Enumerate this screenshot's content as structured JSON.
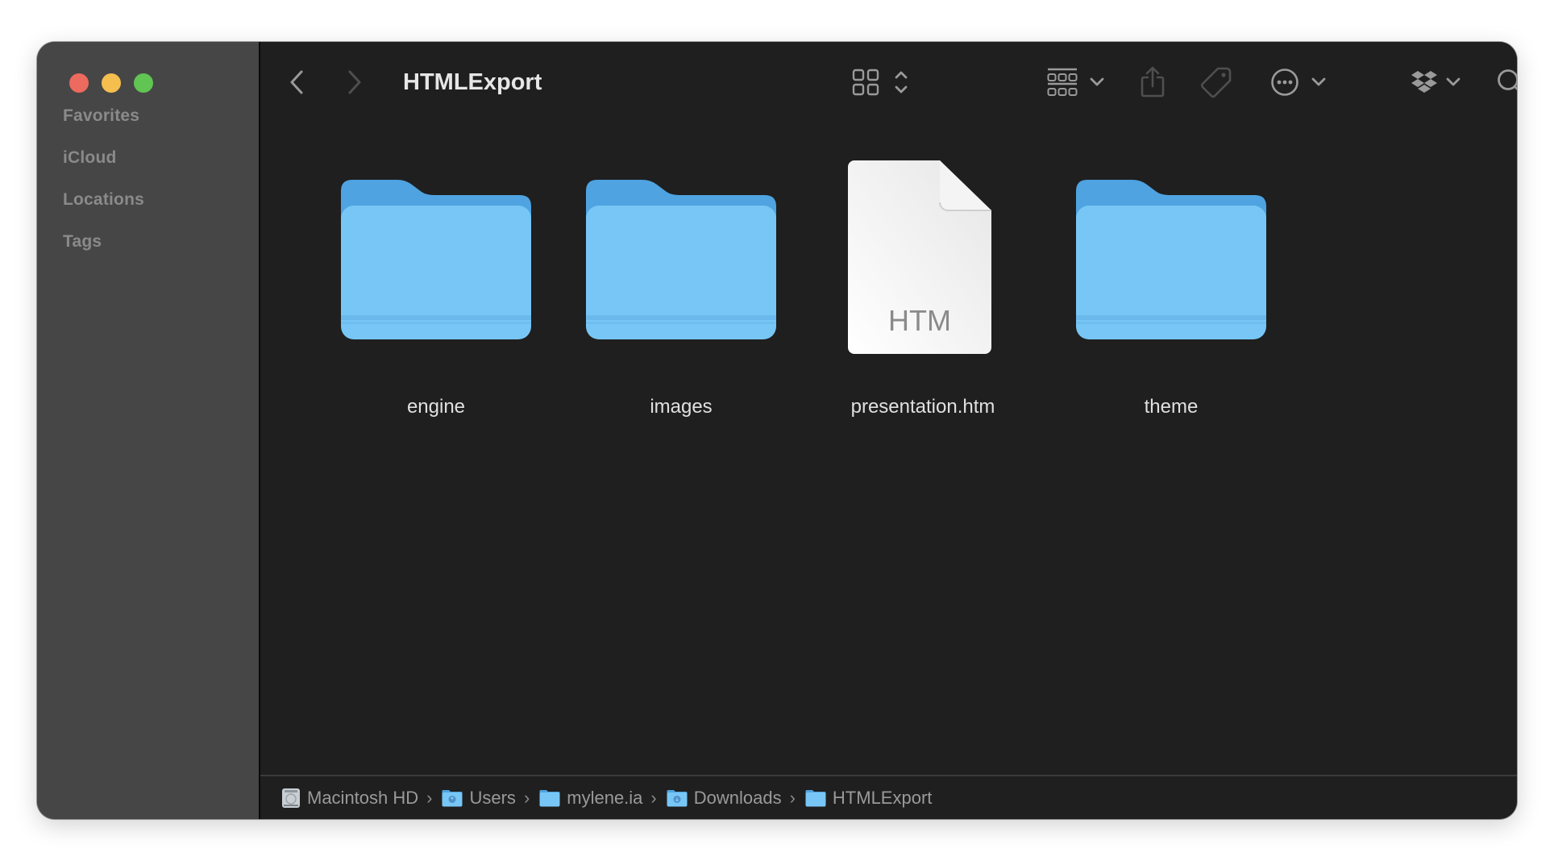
{
  "window": {
    "title": "HTMLExport",
    "traffic_lights": [
      {
        "name": "close",
        "color": "#ed6a5e"
      },
      {
        "name": "minimize",
        "color": "#f5bf4f"
      },
      {
        "name": "zoom",
        "color": "#61c554"
      }
    ]
  },
  "sidebar": {
    "sections": [
      {
        "label": "Favorites"
      },
      {
        "label": "iCloud"
      },
      {
        "label": "Locations"
      },
      {
        "label": "Tags"
      }
    ]
  },
  "toolbar": {
    "back": "chevron-left-icon",
    "forward": "chevron-right-icon",
    "title": "HTMLExport",
    "view_mode": "icon-view",
    "group": "group-by",
    "share": {
      "icon": "share-icon",
      "enabled": false
    },
    "tag": {
      "icon": "tag-icon",
      "enabled": false
    },
    "more": "ellipsis-circle-icon",
    "dropbox": "dropbox-icon",
    "search": "search-icon"
  },
  "items": [
    {
      "name": "engine",
      "kind": "folder"
    },
    {
      "name": "images",
      "kind": "folder"
    },
    {
      "name": "presentation.htm",
      "kind": "file",
      "badge": "HTM"
    },
    {
      "name": "theme",
      "kind": "folder"
    }
  ],
  "pathbar": [
    {
      "label": "Macintosh HD",
      "icon": "hard-drive-icon"
    },
    {
      "label": "Users",
      "icon": "users-folder-icon"
    },
    {
      "label": "mylene.ia",
      "icon": "folder-icon"
    },
    {
      "label": "Downloads",
      "icon": "downloads-folder-icon"
    },
    {
      "label": "HTMLExport",
      "icon": "folder-icon"
    }
  ],
  "colors": {
    "folder": "#77c6f5",
    "folder_back": "#4fa3e0",
    "sidebar_bg": "#464646",
    "content_bg": "#1f1f1f"
  }
}
